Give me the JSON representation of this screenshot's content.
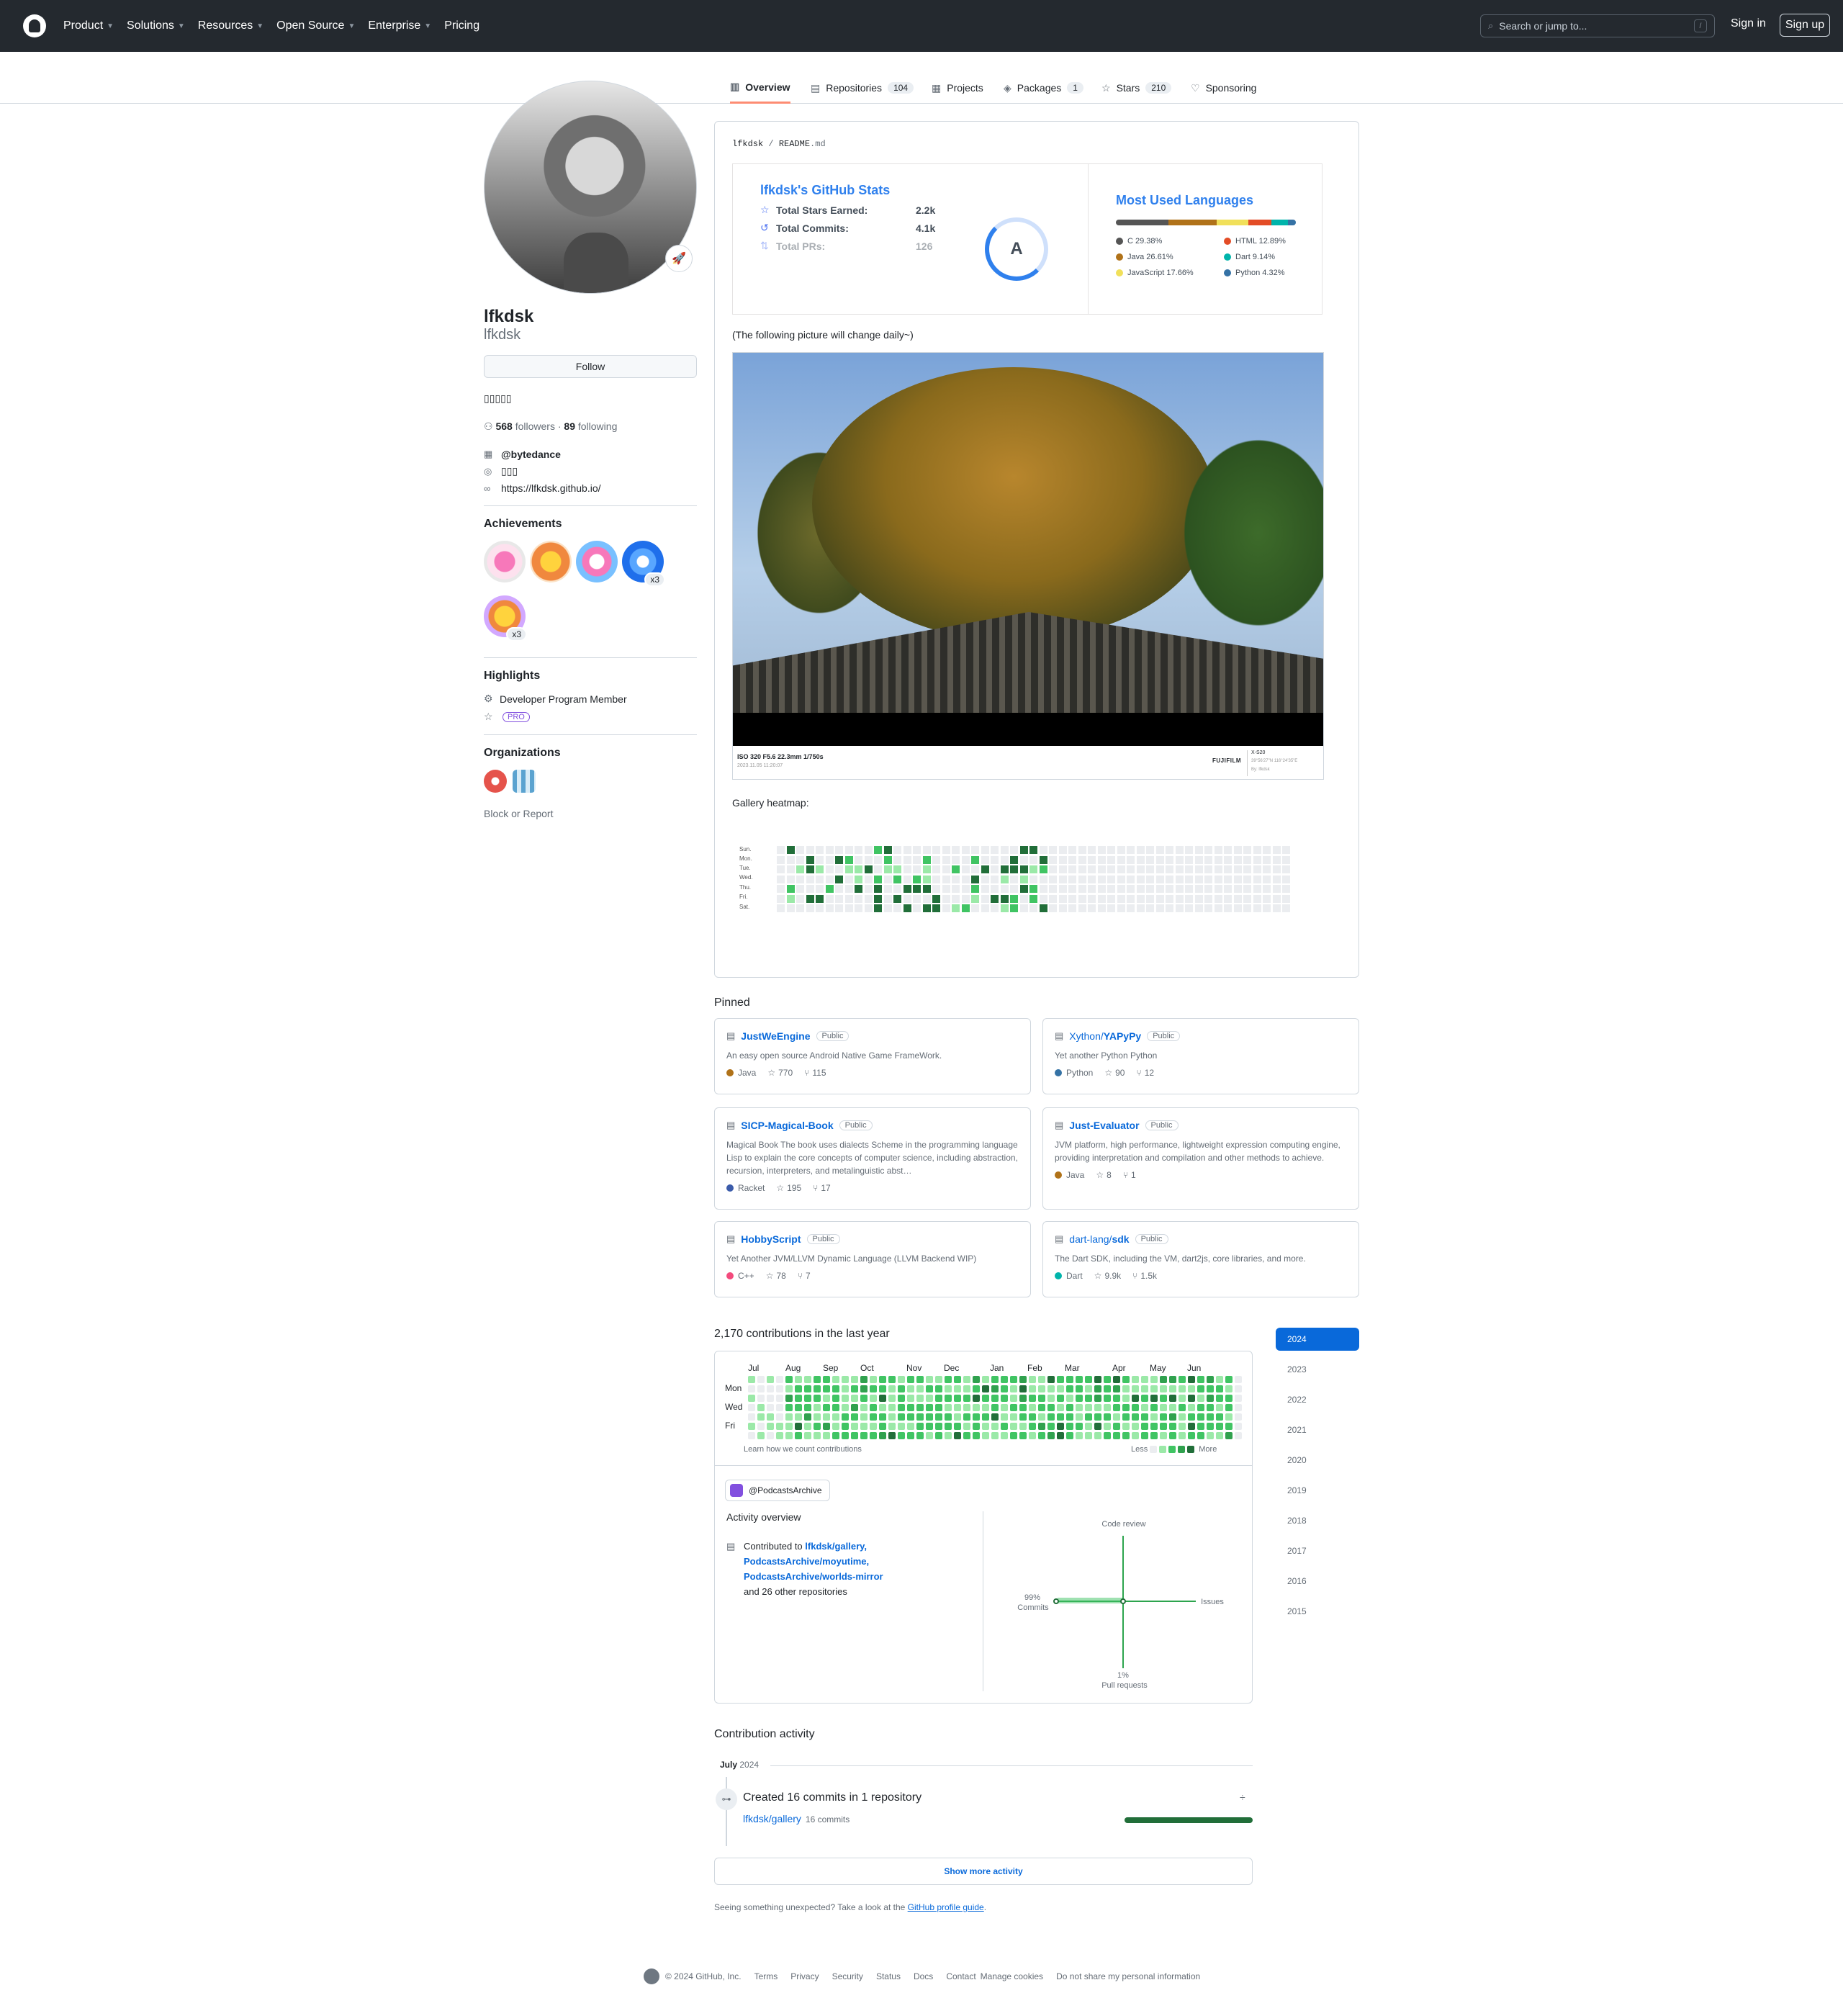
{
  "nav": {
    "items": [
      "Product",
      "Solutions",
      "Resources",
      "Open Source",
      "Enterprise",
      "Pricing"
    ],
    "search_placeholder": "Search or jump to...",
    "search_key": "/",
    "signin": "Sign in",
    "signup": "Sign up"
  },
  "tabs": {
    "overview": "Overview",
    "repositories": "Repositories",
    "repositories_count": "104",
    "projects": "Projects",
    "packages": "Packages",
    "packages_count": "1",
    "stars": "Stars",
    "stars_count": "210",
    "sponsoring": "Sponsoring"
  },
  "profile": {
    "status_emoji": "🚀",
    "name": "lfkdsk",
    "login": "lfkdsk",
    "follow_label": "Follow",
    "bio": "▯▯▯▯▯",
    "followers": "568",
    "followers_label": "followers",
    "following": "89",
    "following_label": "following",
    "company": "@bytedance",
    "location": "▯▯▯",
    "website": "https://lfkdsk.github.io/",
    "achievements_title": "Achievements",
    "achievement_count_a": "x3",
    "achievement_count_b": "x3",
    "highlights_title": "Highlights",
    "highlight_1": "Developer Program Member",
    "pro_label": "PRO",
    "orgs_title": "Organizations",
    "block_report": "Block or Report"
  },
  "readme": {
    "path_user": "lfkdsk",
    "path_sep": "/",
    "path_file": "README",
    "path_ext": ".md",
    "stats_title": "lfkdsk's GitHub Stats",
    "stats": [
      {
        "label": "Total Stars Earned:",
        "value": "2.2k"
      },
      {
        "label": "Total Commits:",
        "value": "4.1k"
      },
      {
        "label": "Total PRs:",
        "value": "126"
      }
    ],
    "grade": "A",
    "langs_title": "Most Used Languages",
    "langs": [
      {
        "name": "C 29.38%",
        "color": "#555555"
      },
      {
        "name": "HTML 12.89%",
        "color": "#e34c26"
      },
      {
        "name": "Java 26.61%",
        "color": "#b07219"
      },
      {
        "name": "Dart 9.14%",
        "color": "#00b4ab"
      },
      {
        "name": "JavaScript 17.66%",
        "color": "#f1e05a"
      },
      {
        "name": "Python 4.32%",
        "color": "#3572a5"
      }
    ],
    "daily_note": "(The following picture will change daily~)",
    "photo_caption_left": "ISO 320 F5.6 22.3mm 1/750s",
    "photo_caption_left2": "2023.11.05 11:20:07",
    "photo_brand": "FUJIFILM",
    "photo_caption_right": "X-S20",
    "photo_caption_right2": "39°56'27\"N 116°24'35\"E",
    "photo_caption_right3": "By: lfkdsk",
    "heatmap_title": "Gallery heatmap:",
    "heatmap_days": [
      "Sun.",
      "Mon.",
      "Tue.",
      "Wed.",
      "Thu.",
      "Fri.",
      "Sat."
    ]
  },
  "pinned": {
    "title": "Pinned",
    "public_label": "Public",
    "repos": [
      {
        "owner": "",
        "name": "JustWeEngine",
        "desc": "An easy open source Android Native Game FrameWork.",
        "lang": "Java",
        "lang_color": "#b07219",
        "stars": "770",
        "forks": "115"
      },
      {
        "owner": "Xython/",
        "name": "YAPyPy",
        "desc": "Yet another Python Python",
        "lang": "Python",
        "lang_color": "#3572a5",
        "stars": "90",
        "forks": "12"
      },
      {
        "owner": "",
        "name": "SICP-Magical-Book",
        "desc": "Magical Book The book uses dialects Scheme in the programming language Lisp to explain the core concepts of computer science, including abstraction, recursion, interpreters, and metalinguistic abst…",
        "lang": "Racket",
        "lang_color": "#3c5caa",
        "stars": "195",
        "forks": "17"
      },
      {
        "owner": "",
        "name": "Just-Evaluator",
        "desc": "JVM platform, high performance, lightweight expression computing engine, providing interpretation and compilation and other methods to achieve.",
        "lang": "Java",
        "lang_color": "#b07219",
        "stars": "8",
        "forks": "1"
      },
      {
        "owner": "",
        "name": "HobbyScript",
        "desc": "Yet Another JVM/LLVM Dynamic Language (LLVM Backend WIP)",
        "lang": "C++",
        "lang_color": "#f34b7d",
        "stars": "78",
        "forks": "7"
      },
      {
        "owner": "dart-lang/",
        "name": "sdk",
        "desc": "The Dart SDK, including the VM, dart2js, core libraries, and more.",
        "lang": "Dart",
        "lang_color": "#00b4ab",
        "stars": "9.9k",
        "forks": "1.5k"
      }
    ]
  },
  "contributions": {
    "title": "2,170 contributions in the last year",
    "months": [
      "Jul",
      "Aug",
      "Sep",
      "Oct",
      "Nov",
      "Dec",
      "Jan",
      "Feb",
      "Mar",
      "Apr",
      "May",
      "Jun"
    ],
    "days": [
      "Mon",
      "Wed",
      "Fri"
    ],
    "learn": "Learn how we count contributions",
    "less": "Less",
    "more": "More",
    "colors": [
      "#ebedf0",
      "#9be9a8",
      "#40c463",
      "#30a14e",
      "#216e39"
    ],
    "org": "@PodcastsArchive",
    "activity_title": "Activity overview",
    "contributed_to": "Contributed to",
    "repo_1": "lfkdsk/gallery,",
    "repo_2": "PodcastsArchive/moyutime,",
    "repo_3": "PodcastsArchive/worlds-mirror",
    "others": "and 26 other repositories",
    "code_review": "Code review",
    "issues": "Issues",
    "commits_pct": "99%",
    "commits": "Commits",
    "prs_pct": "1%",
    "prs": "Pull requests"
  },
  "years": [
    "2024",
    "2023",
    "2022",
    "2021",
    "2020",
    "2019",
    "2018",
    "2017",
    "2016",
    "2015"
  ],
  "activity": {
    "title": "Contribution activity",
    "month": "July",
    "year": "2024",
    "created": "Created 16 commits in 1 repository",
    "repo": "lfkdsk/gallery",
    "repo_commits": "16 commits",
    "toggle": "÷",
    "show_more": "Show more activity",
    "unexpected": "Seeing something unexpected? Take a look at the",
    "guide": "GitHub profile guide",
    "period": "."
  },
  "footer": {
    "copyright": "© 2024 GitHub, Inc.",
    "links": [
      "Terms",
      "Privacy",
      "Security",
      "Status",
      "Docs",
      "Contact",
      "Manage cookies",
      "Do not share my personal information"
    ]
  }
}
